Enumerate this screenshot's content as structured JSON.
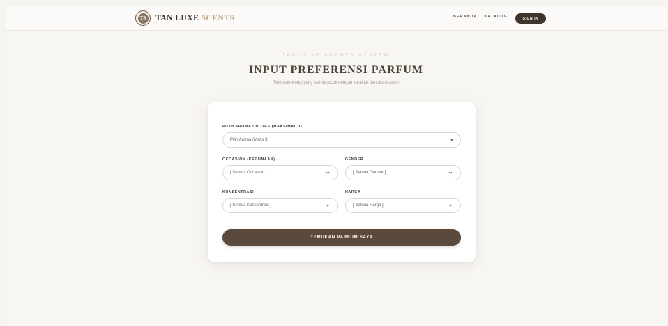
{
  "nav": {
    "brand_main": "TAN LUXE",
    "brand_accent": "SCENTS",
    "logo_text": "TS",
    "links": [
      "BERANDA",
      "KATALOG"
    ],
    "signin_label": "SIGN IN"
  },
  "hero": {
    "eyebrow": "TAN LUXE SCENTS SYSTEM",
    "title": "INPUT PREFERENSI PARFUM",
    "subtitle": "Temukan wangi yang paling cocok dengan karakter dan aktivitasmu"
  },
  "form": {
    "aroma": {
      "label": "PILIH AROMA / NOTES (MAKSIMAL 3)",
      "value": "Pilih Aroma (Maks 3)"
    },
    "occasion": {
      "label": "OCCASION (KEGUNAAN)",
      "value": "[ Semua Occasion ]"
    },
    "gender": {
      "label": "GENDER",
      "value": "[ Semua Gender ]"
    },
    "konsentrasi": {
      "label": "KONSENTRASI",
      "value": "[ Semua Konsentrasi ]"
    },
    "harga": {
      "label": "HARGA",
      "value": "[ Semua Harga ]"
    },
    "submit_label": "TEMUKAN PARFUM SAYA"
  },
  "colors": {
    "accent": "#c2a788",
    "primary_button": "#5b4a3b",
    "signin_button": "#3f352c",
    "background": "#f8f6f3"
  },
  "icons": {
    "logo": "monogram-logo-icon",
    "dropdown": "chevron-down-icon",
    "multiselect": "caret-down-icon"
  }
}
